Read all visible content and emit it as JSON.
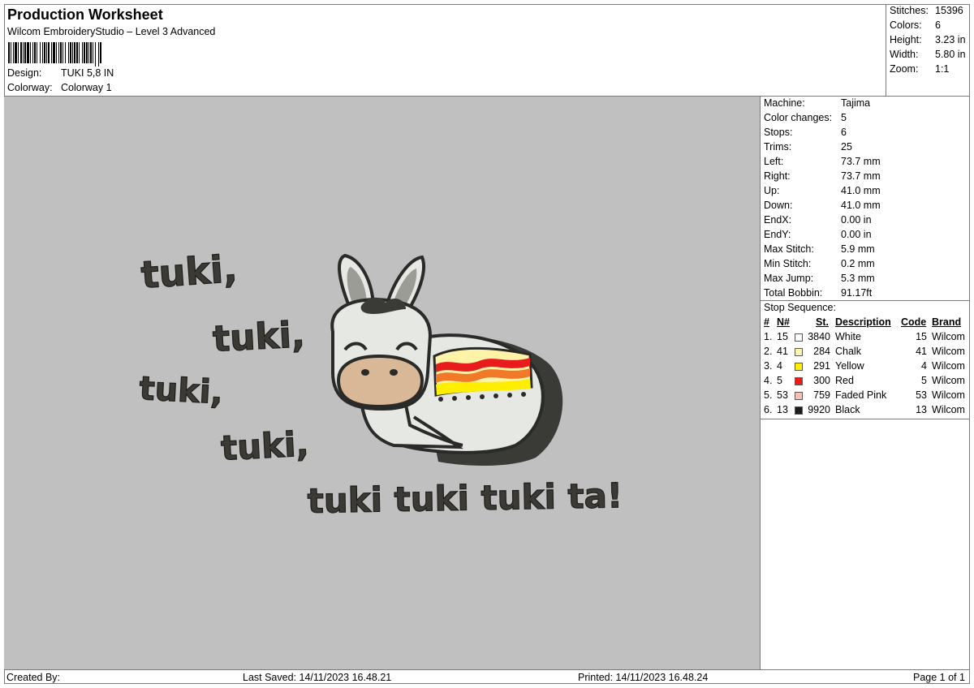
{
  "header": {
    "title": "Production Worksheet",
    "software": "Wilcom EmbroideryStudio – Level 3 Advanced",
    "design_label": "Design:",
    "design_value": "TUKI 5,8 IN",
    "colorway_label": "Colorway:",
    "colorway_value": "Colorway 1"
  },
  "summary": {
    "stitches_label": "Stitches:",
    "stitches": "15396",
    "colors_label": "Colors:",
    "colors": "6",
    "height_label": "Height:",
    "height": "3.23 in",
    "width_label": "Width:",
    "width": "5.80 in",
    "zoom_label": "Zoom:",
    "zoom": "1:1"
  },
  "machine": {
    "machine_label": "Machine:",
    "machine": "Tajima",
    "color_changes_label": "Color changes:",
    "color_changes": "5",
    "stops_label": "Stops:",
    "stops": "6",
    "trims_label": "Trims:",
    "trims": "25",
    "left_label": "Left:",
    "left": "73.7 mm",
    "right_label": "Right:",
    "right": "73.7 mm",
    "up_label": "Up:",
    "up": "41.0 mm",
    "down_label": "Down:",
    "down": "41.0 mm",
    "endx_label": "EndX:",
    "endx": "0.00 in",
    "endy_label": "EndY:",
    "endy": "0.00 in",
    "max_stitch_label": "Max Stitch:",
    "max_stitch": "5.9 mm",
    "min_stitch_label": "Min Stitch:",
    "min_stitch": "0.2 mm",
    "max_jump_label": "Max Jump:",
    "max_jump": "5.3 mm",
    "total_bobbin_label": "Total Bobbin:",
    "total_bobbin": "91.17ft"
  },
  "stop_sequence": {
    "title": "Stop Sequence:",
    "headers": {
      "num": "#",
      "n": "N#",
      "st": "St.",
      "description": "Description",
      "code": "Code",
      "brand": "Brand"
    },
    "rows": [
      {
        "num": "1.",
        "n": "15",
        "color": "#ffffff",
        "st": "3840",
        "description": "White",
        "code": "15",
        "brand": "Wilcom"
      },
      {
        "num": "2.",
        "n": "41",
        "color": "#fff5b0",
        "st": "284",
        "description": "Chalk",
        "code": "41",
        "brand": "Wilcom"
      },
      {
        "num": "3.",
        "n": "4",
        "color": "#ffee00",
        "st": "291",
        "description": "Yellow",
        "code": "4",
        "brand": "Wilcom"
      },
      {
        "num": "4.",
        "n": "5",
        "color": "#e81c1c",
        "st": "300",
        "description": "Red",
        "code": "5",
        "brand": "Wilcom"
      },
      {
        "num": "5.",
        "n": "53",
        "color": "#f5c2b4",
        "st": "759",
        "description": "Faded Pink",
        "code": "53",
        "brand": "Wilcom"
      },
      {
        "num": "6.",
        "n": "13",
        "color": "#1c1c1c",
        "st": "9920",
        "description": "Black",
        "code": "13",
        "brand": "Wilcom"
      }
    ]
  },
  "design_text": {
    "line1": "tuki,",
    "line2": "tuki,",
    "line3": "tuki,",
    "line4": "tuki,",
    "line5": "tuki tuki tuki ta!"
  },
  "footer": {
    "created_by": "Created By:",
    "last_saved": "Last Saved: 14/11/2023 16.48.21",
    "printed": "Printed: 14/11/2023 16.48.24",
    "page": "Page 1 of 1"
  }
}
